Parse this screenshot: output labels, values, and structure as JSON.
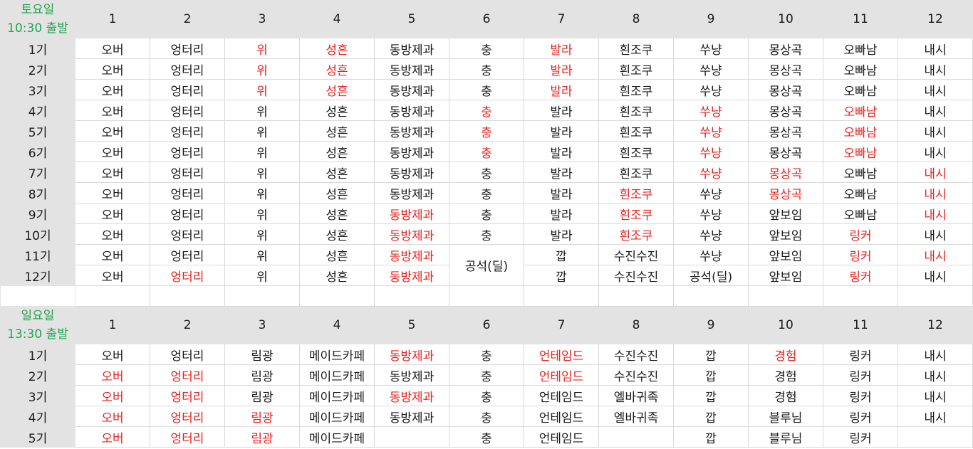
{
  "sections": [
    {
      "day": "토요일",
      "time": "10:30 출발",
      "columns": [
        "1",
        "2",
        "3",
        "4",
        "5",
        "6",
        "7",
        "8",
        "9",
        "10",
        "11",
        "12"
      ],
      "rows": [
        {
          "label": "1기",
          "cells": [
            {
              "t": "오버"
            },
            {
              "t": "엉터리"
            },
            {
              "t": "위",
              "r": 1
            },
            {
              "t": "성흔",
              "r": 1
            },
            {
              "t": "동방제과"
            },
            {
              "t": "충"
            },
            {
              "t": "발라",
              "r": 1
            },
            {
              "t": "흰조쿠"
            },
            {
              "t": "쑤냥"
            },
            {
              "t": "몽상곡"
            },
            {
              "t": "오빠남"
            },
            {
              "t": "내시"
            }
          ]
        },
        {
          "label": "2기",
          "cells": [
            {
              "t": "오버"
            },
            {
              "t": "엉터리"
            },
            {
              "t": "위",
              "r": 1
            },
            {
              "t": "성흔",
              "r": 1
            },
            {
              "t": "동방제과"
            },
            {
              "t": "충"
            },
            {
              "t": "발라",
              "r": 1
            },
            {
              "t": "흰조쿠"
            },
            {
              "t": "쑤냥"
            },
            {
              "t": "몽상곡"
            },
            {
              "t": "오빠남"
            },
            {
              "t": "내시"
            }
          ]
        },
        {
          "label": "3기",
          "cells": [
            {
              "t": "오버"
            },
            {
              "t": "엉터리"
            },
            {
              "t": "위",
              "r": 1
            },
            {
              "t": "성흔",
              "r": 1
            },
            {
              "t": "동방제과"
            },
            {
              "t": "충"
            },
            {
              "t": "발라",
              "r": 1
            },
            {
              "t": "흰조쿠"
            },
            {
              "t": "쑤냥"
            },
            {
              "t": "몽상곡"
            },
            {
              "t": "오빠남"
            },
            {
              "t": "내시"
            }
          ]
        },
        {
          "label": "4기",
          "cells": [
            {
              "t": "오버"
            },
            {
              "t": "엉터리"
            },
            {
              "t": "위"
            },
            {
              "t": "성흔"
            },
            {
              "t": "동방제과"
            },
            {
              "t": "충",
              "r": 1
            },
            {
              "t": "발라"
            },
            {
              "t": "흰조쿠"
            },
            {
              "t": "쑤냥",
              "r": 1
            },
            {
              "t": "몽상곡"
            },
            {
              "t": "오빠남",
              "r": 1
            },
            {
              "t": "내시"
            }
          ]
        },
        {
          "label": "5기",
          "cells": [
            {
              "t": "오버"
            },
            {
              "t": "엉터리"
            },
            {
              "t": "위"
            },
            {
              "t": "성흔"
            },
            {
              "t": "동방제과"
            },
            {
              "t": "충",
              "r": 1
            },
            {
              "t": "발라"
            },
            {
              "t": "흰조쿠"
            },
            {
              "t": "쑤냥",
              "r": 1
            },
            {
              "t": "몽상곡"
            },
            {
              "t": "오빠남",
              "r": 1
            },
            {
              "t": "내시"
            }
          ]
        },
        {
          "label": "6기",
          "cells": [
            {
              "t": "오버"
            },
            {
              "t": "엉터리"
            },
            {
              "t": "위"
            },
            {
              "t": "성흔"
            },
            {
              "t": "동방제과"
            },
            {
              "t": "충",
              "r": 1
            },
            {
              "t": "발라"
            },
            {
              "t": "흰조쿠"
            },
            {
              "t": "쑤냥",
              "r": 1
            },
            {
              "t": "몽상곡"
            },
            {
              "t": "오빠남",
              "r": 1
            },
            {
              "t": "내시"
            }
          ]
        },
        {
          "label": "7기",
          "cells": [
            {
              "t": "오버"
            },
            {
              "t": "엉터리"
            },
            {
              "t": "위"
            },
            {
              "t": "성흔"
            },
            {
              "t": "동방제과"
            },
            {
              "t": "충"
            },
            {
              "t": "발라"
            },
            {
              "t": "흰조쿠"
            },
            {
              "t": "쑤냥",
              "r": 1
            },
            {
              "t": "몽상곡",
              "r": 1
            },
            {
              "t": "오빠남"
            },
            {
              "t": "내시",
              "r": 1
            }
          ]
        },
        {
          "label": "8기",
          "cells": [
            {
              "t": "오버"
            },
            {
              "t": "엉터리"
            },
            {
              "t": "위"
            },
            {
              "t": "성흔"
            },
            {
              "t": "동방제과"
            },
            {
              "t": "충"
            },
            {
              "t": "발라"
            },
            {
              "t": "흰조쿠",
              "r": 1
            },
            {
              "t": "쑤냥"
            },
            {
              "t": "몽상곡",
              "r": 1
            },
            {
              "t": "오빠남"
            },
            {
              "t": "내시",
              "r": 1
            }
          ]
        },
        {
          "label": "9기",
          "cells": [
            {
              "t": "오버"
            },
            {
              "t": "엉터리"
            },
            {
              "t": "위"
            },
            {
              "t": "성흔"
            },
            {
              "t": "동방제과",
              "r": 1
            },
            {
              "t": "충"
            },
            {
              "t": "발라"
            },
            {
              "t": "흰조쿠",
              "r": 1
            },
            {
              "t": "쑤냥"
            },
            {
              "t": "앞보임"
            },
            {
              "t": "오빠남"
            },
            {
              "t": "내시",
              "r": 1
            }
          ]
        },
        {
          "label": "10기",
          "cells": [
            {
              "t": "오버"
            },
            {
              "t": "엉터리"
            },
            {
              "t": "위"
            },
            {
              "t": "성흔"
            },
            {
              "t": "동방제과",
              "r": 1
            },
            {
              "t": "충"
            },
            {
              "t": "발라"
            },
            {
              "t": "흰조쿠",
              "r": 1
            },
            {
              "t": "쑤냥"
            },
            {
              "t": "앞보임"
            },
            {
              "t": "링커",
              "r": 1
            },
            {
              "t": "내시"
            }
          ]
        },
        {
          "label": "11기",
          "cells": [
            {
              "t": "오버"
            },
            {
              "t": "엉터리"
            },
            {
              "t": "위"
            },
            {
              "t": "성흔"
            },
            {
              "t": "동방제과",
              "r": 1
            },
            {
              "t": "공석(딜)",
              "rs": 2
            },
            {
              "t": "깝"
            },
            {
              "t": "수진수진"
            },
            {
              "t": "쑤냥"
            },
            {
              "t": "앞보임"
            },
            {
              "t": "링커",
              "r": 1
            },
            {
              "t": "내시",
              "r": 1
            }
          ]
        },
        {
          "label": "12기",
          "cells": [
            {
              "t": "오버"
            },
            {
              "t": "엉터리",
              "r": 1
            },
            {
              "t": "위"
            },
            {
              "t": "성흔"
            },
            {
              "t": "동방제과",
              "r": 1
            },
            {
              "skip": 1
            },
            {
              "t": "깝"
            },
            {
              "t": "수진수진"
            },
            {
              "t": "공석(딜)"
            },
            {
              "t": "앞보임"
            },
            {
              "t": "링커",
              "r": 1
            },
            {
              "t": "내시"
            }
          ]
        }
      ]
    },
    {
      "day": "일요일",
      "time": "13:30 출발",
      "columns": [
        "1",
        "2",
        "3",
        "4",
        "5",
        "6",
        "7",
        "8",
        "9",
        "10",
        "11",
        "12"
      ],
      "rows": [
        {
          "label": "1기",
          "cells": [
            {
              "t": "오버"
            },
            {
              "t": "엉터리"
            },
            {
              "t": "림광"
            },
            {
              "t": "메이드카페"
            },
            {
              "t": "동방제과",
              "r": 1
            },
            {
              "t": "충"
            },
            {
              "t": "언테임드",
              "r": 1
            },
            {
              "t": "수진수진"
            },
            {
              "t": "깝"
            },
            {
              "t": "경험",
              "r": 1
            },
            {
              "t": "링커"
            },
            {
              "t": "내시"
            }
          ]
        },
        {
          "label": "2기",
          "cells": [
            {
              "t": "오버",
              "r": 1
            },
            {
              "t": "엉터리",
              "r": 1
            },
            {
              "t": "림광"
            },
            {
              "t": "메이드카페"
            },
            {
              "t": "동방제과"
            },
            {
              "t": "충"
            },
            {
              "t": "언테임드",
              "r": 1
            },
            {
              "t": "수진수진"
            },
            {
              "t": "깝"
            },
            {
              "t": "경험"
            },
            {
              "t": "링커"
            },
            {
              "t": "내시"
            }
          ]
        },
        {
          "label": "3기",
          "cells": [
            {
              "t": "오버",
              "r": 1
            },
            {
              "t": "엉터리",
              "r": 1
            },
            {
              "t": "림광"
            },
            {
              "t": "메이드카페"
            },
            {
              "t": "동방제과",
              "r": 1
            },
            {
              "t": "충"
            },
            {
              "t": "언테임드"
            },
            {
              "t": "엘바귀족"
            },
            {
              "t": "깝"
            },
            {
              "t": "경험"
            },
            {
              "t": "링커"
            },
            {
              "t": "내시"
            }
          ]
        },
        {
          "label": "4기",
          "cells": [
            {
              "t": "오버",
              "r": 1
            },
            {
              "t": "엉터리",
              "r": 1
            },
            {
              "t": "림광",
              "r": 1
            },
            {
              "t": "메이드카페"
            },
            {
              "t": "동방제과"
            },
            {
              "t": "충"
            },
            {
              "t": "언테임드"
            },
            {
              "t": "엘바귀족"
            },
            {
              "t": "깝"
            },
            {
              "t": "블루님"
            },
            {
              "t": "링커"
            },
            {
              "t": "내시"
            }
          ]
        },
        {
          "label": "5기",
          "cells": [
            {
              "t": "오버",
              "r": 1
            },
            {
              "t": "엉터리",
              "r": 1
            },
            {
              "t": "림광",
              "r": 1
            },
            {
              "t": "메이드카페"
            },
            {
              "t": ""
            },
            {
              "t": "충"
            },
            {
              "t": "언테임드"
            },
            {
              "t": ""
            },
            {
              "t": "깝"
            },
            {
              "t": "블루님"
            },
            {
              "t": "링커"
            },
            {
              "t": ""
            }
          ]
        }
      ]
    }
  ]
}
